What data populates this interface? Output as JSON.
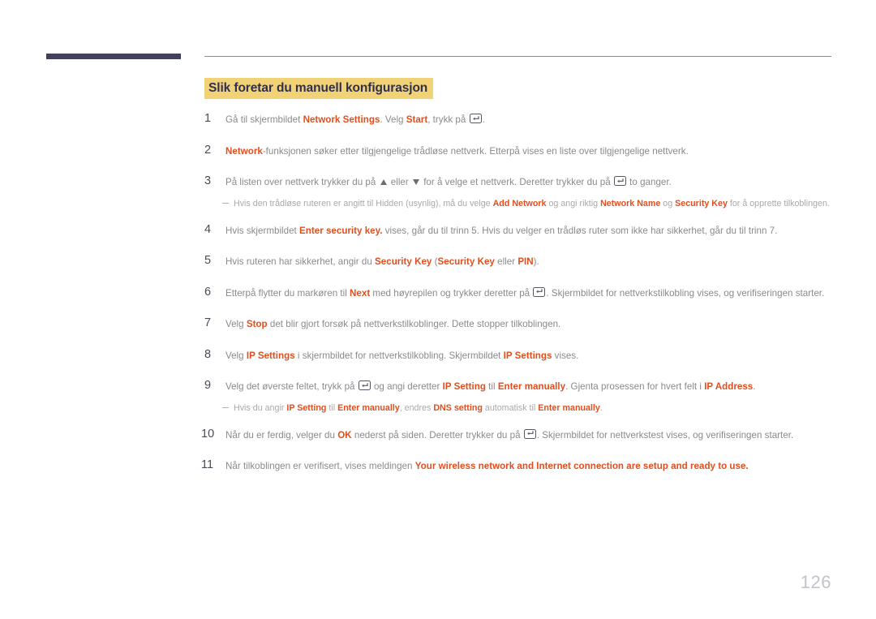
{
  "document": {
    "page_number": "126",
    "heading": "Slik foretar du manuell konfigurasjon",
    "colors": {
      "heading_highlight": "#f2d277",
      "heading_text": "#2f2f4f",
      "emphasis": "#e24f1e",
      "body_text": "#8a8a8a",
      "note_text": "#a9a9a9",
      "corner_bar": "#41415e",
      "page_number": "#c3c3cb"
    }
  },
  "steps": [
    {
      "number": "1",
      "segments": [
        {
          "text": "Gå til skjermbildet ",
          "emphasis": false
        },
        {
          "text": "Network Settings",
          "emphasis": true
        },
        {
          "text": ". Velg ",
          "emphasis": false
        },
        {
          "text": "Start",
          "emphasis": true
        },
        {
          "text": ", trykk på ",
          "emphasis": false
        },
        {
          "icon": "enter-key-icon"
        },
        {
          "text": ".",
          "emphasis": false
        }
      ]
    },
    {
      "number": "2",
      "segments": [
        {
          "text": "Network",
          "emphasis": true
        },
        {
          "text": "-funksjonen søker etter tilgjengelige trådløse nettverk. Etterpå vises en liste over tilgjengelige nettverk.",
          "emphasis": false
        }
      ]
    },
    {
      "number": "3",
      "segments": [
        {
          "text": "På listen over nettverk trykker du på ",
          "emphasis": false
        },
        {
          "icon": "triangle-up-icon"
        },
        {
          "text": " eller ",
          "emphasis": false
        },
        {
          "icon": "triangle-down-icon"
        },
        {
          "text": " for å velge et nettverk. Deretter trykker du på ",
          "emphasis": false
        },
        {
          "icon": "enter-key-icon"
        },
        {
          "text": " to ganger.",
          "emphasis": false
        }
      ],
      "note": {
        "segments": [
          {
            "text": "Hvis den trådløse ruteren er angitt til Hidden (usynlig), må du velge ",
            "emphasis": false
          },
          {
            "text": "Add Network",
            "emphasis": true
          },
          {
            "text": " og angi riktig ",
            "emphasis": false
          },
          {
            "text": "Network Name",
            "emphasis": true
          },
          {
            "text": " og ",
            "emphasis": false
          },
          {
            "text": "Security Key",
            "emphasis": true
          },
          {
            "text": " for å opprette tilkoblingen.",
            "emphasis": false
          }
        ]
      }
    },
    {
      "number": "4",
      "segments": [
        {
          "text": "Hvis skjermbildet ",
          "emphasis": false
        },
        {
          "text": "Enter security key.",
          "emphasis": true
        },
        {
          "text": " vises, går du til trinn 5. Hvis du velger en trådløs ruter som ikke har sikkerhet, går du til trinn 7.",
          "emphasis": false
        }
      ]
    },
    {
      "number": "5",
      "segments": [
        {
          "text": "Hvis ruteren har sikkerhet, angir du ",
          "emphasis": false
        },
        {
          "text": "Security Key",
          "emphasis": true
        },
        {
          "text": " (",
          "emphasis": false
        },
        {
          "text": "Security Key",
          "emphasis": true
        },
        {
          "text": " eller ",
          "emphasis": false
        },
        {
          "text": "PIN",
          "emphasis": true
        },
        {
          "text": ").",
          "emphasis": false
        }
      ]
    },
    {
      "number": "6",
      "segments": [
        {
          "text": "Etterpå flytter du markøren til ",
          "emphasis": false
        },
        {
          "text": "Next",
          "emphasis": true
        },
        {
          "text": " med høyrepilen og trykker deretter på ",
          "emphasis": false
        },
        {
          "icon": "enter-key-icon"
        },
        {
          "text": ". Skjermbildet for nettverkstilkobling vises, og verifiseringen starter.",
          "emphasis": false
        }
      ]
    },
    {
      "number": "7",
      "segments": [
        {
          "text": "Velg ",
          "emphasis": false
        },
        {
          "text": "Stop",
          "emphasis": true
        },
        {
          "text": " det blir gjort forsøk på nettverkstilkoblinger. Dette stopper tilkoblingen.",
          "emphasis": false
        }
      ]
    },
    {
      "number": "8",
      "segments": [
        {
          "text": "Velg ",
          "emphasis": false
        },
        {
          "text": "IP Settings",
          "emphasis": true
        },
        {
          "text": " i skjermbildet for nettverkstilkobling. Skjermbildet ",
          "emphasis": false
        },
        {
          "text": "IP Settings",
          "emphasis": true
        },
        {
          "text": " vises.",
          "emphasis": false
        }
      ]
    },
    {
      "number": "9",
      "segments": [
        {
          "text": "Velg det øverste feltet, trykk på ",
          "emphasis": false
        },
        {
          "icon": "enter-key-icon"
        },
        {
          "text": " og angi deretter ",
          "emphasis": false
        },
        {
          "text": "IP Setting",
          "emphasis": true
        },
        {
          "text": " til ",
          "emphasis": false
        },
        {
          "text": "Enter manually",
          "emphasis": true
        },
        {
          "text": ". Gjenta prosessen for hvert felt i ",
          "emphasis": false
        },
        {
          "text": "IP Address",
          "emphasis": true
        },
        {
          "text": ".",
          "emphasis": false
        }
      ],
      "note": {
        "segments": [
          {
            "text": "Hvis du angir ",
            "emphasis": false
          },
          {
            "text": "IP Setting",
            "emphasis": true
          },
          {
            "text": " til ",
            "emphasis": false
          },
          {
            "text": "Enter manually",
            "emphasis": true
          },
          {
            "text": ", endres ",
            "emphasis": false
          },
          {
            "text": "DNS setting",
            "emphasis": true
          },
          {
            "text": " automatisk til ",
            "emphasis": false
          },
          {
            "text": "Enter manually",
            "emphasis": true
          },
          {
            "text": ".",
            "emphasis": false
          }
        ]
      }
    },
    {
      "number": "10",
      "segments": [
        {
          "text": "Når du er ferdig, velger du ",
          "emphasis": false
        },
        {
          "text": "OK",
          "emphasis": true
        },
        {
          "text": " nederst på siden. Deretter trykker du på ",
          "emphasis": false
        },
        {
          "icon": "enter-key-icon"
        },
        {
          "text": ". Skjermbildet for nettverkstest vises, og verifiseringen starter.",
          "emphasis": false
        }
      ]
    },
    {
      "number": "11",
      "segments": [
        {
          "text": "Når tilkoblingen er verifisert, vises meldingen ",
          "emphasis": false
        },
        {
          "text": "Your wireless network and Internet connection are setup and ready to use.",
          "emphasis": true
        }
      ]
    }
  ]
}
